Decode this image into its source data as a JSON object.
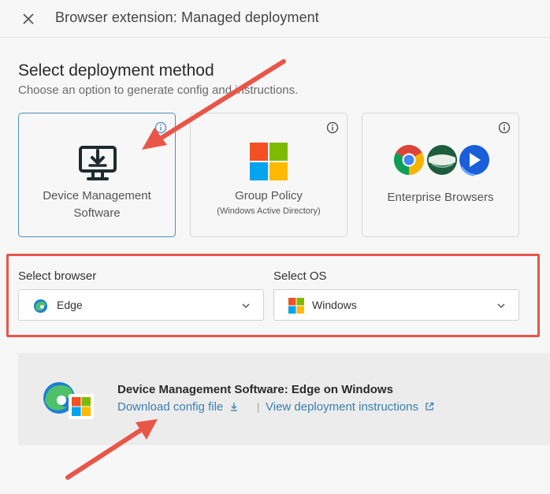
{
  "header": {
    "title": "Browser extension: Managed deployment"
  },
  "deployment": {
    "title": "Select deployment method",
    "description": "Choose an option to generate config and instructions.",
    "cards": [
      {
        "label_line1": "Device Management",
        "label_line2": "Software",
        "icon": "monitor-download-icon",
        "selected": true
      },
      {
        "label_line1": "Group Policy",
        "sublabel": "(Windows Active Directory)",
        "icon": "windows-logo-icon",
        "selected": false
      },
      {
        "label_line1": "Enterprise Browsers",
        "icon": "browser-logos-icon",
        "selected": false
      }
    ]
  },
  "browser_select": {
    "label": "Select browser",
    "value": "Edge",
    "icon": "edge-icon"
  },
  "os_select": {
    "label": "Select OS",
    "value": "Windows",
    "icon": "windows-logo-icon"
  },
  "result": {
    "title": "Device Management Software: Edge on Windows",
    "download_label": "Download config file",
    "separator": "|",
    "instructions_label": "View deployment instructions"
  },
  "colors": {
    "accent": "#4a90bf",
    "link": "#3a7fb0",
    "annotation": "#e8564a",
    "ms_red": "#f25022",
    "ms_green": "#7fba00",
    "ms_blue": "#00a4ef",
    "ms_yellow": "#ffb900"
  }
}
